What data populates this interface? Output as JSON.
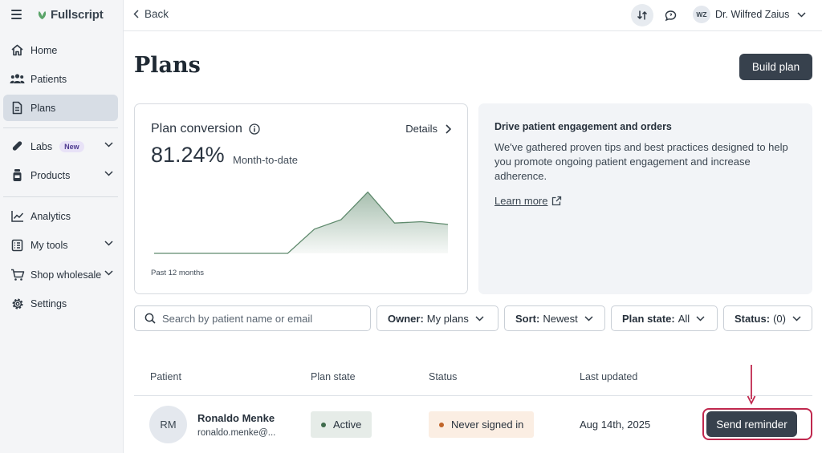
{
  "brand": {
    "name": "Fullscript"
  },
  "sidebar": {
    "items": [
      {
        "label": "Home",
        "icon": "home-icon"
      },
      {
        "label": "Patients",
        "icon": "patients-icon"
      },
      {
        "label": "Plans",
        "icon": "document-icon",
        "active": true
      },
      {
        "label": "Labs",
        "icon": "labs-icon",
        "badge": "New",
        "expandable": true
      },
      {
        "label": "Products",
        "icon": "bottle-icon",
        "expandable": true
      },
      {
        "label": "Analytics",
        "icon": "chart-line-icon"
      },
      {
        "label": "My tools",
        "icon": "tools-icon",
        "expandable": true
      },
      {
        "label": "Shop wholesale",
        "icon": "cart-icon",
        "expandable": true
      },
      {
        "label": "Settings",
        "icon": "gear-icon"
      }
    ]
  },
  "topbar": {
    "back_label": "Back",
    "user_initials": "WZ",
    "user_name": "Dr. Wilfred Zaius"
  },
  "page": {
    "title": "Plans",
    "build_plan_label": "Build plan"
  },
  "conversion_card": {
    "title": "Plan conversion",
    "details_label": "Details",
    "value": "81.24%",
    "value_caption": "Month-to-date",
    "footer": "Past 12 months",
    "accent_color": "#5f8a6d"
  },
  "chart_data": {
    "type": "area",
    "x": [
      1,
      2,
      3,
      4,
      5,
      6,
      7,
      8,
      9,
      10,
      11,
      12
    ],
    "values": [
      0,
      0,
      0,
      0,
      0,
      0,
      0.36,
      0.5,
      0.91,
      0.45,
      0.47,
      0.43
    ],
    "xlabel": "Past 12 months",
    "ylim": [
      0,
      1
    ],
    "grid": false,
    "axes_visible": false
  },
  "info_card": {
    "title": "Drive patient engagement and orders",
    "body": "We've gathered proven tips and best practices designed to help you promote ongoing patient engagement and increase adherence.",
    "link_label": "Learn more"
  },
  "filters": {
    "search_placeholder": "Search by patient name or email",
    "owner": {
      "key": "Owner:",
      "value": "My plans"
    },
    "sort": {
      "key": "Sort:",
      "value": "Newest"
    },
    "plan_state": {
      "key": "Plan state:",
      "value": "All"
    },
    "status": {
      "key": "Status:",
      "value": "(0)"
    }
  },
  "table": {
    "headers": [
      "Patient",
      "Plan state",
      "Status",
      "Last updated"
    ],
    "rows": [
      {
        "initials": "RM",
        "name": "Ronaldo Menke",
        "email": "ronaldo.menke@...",
        "plan_state": "Active",
        "plan_state_color": "#3f6b4c",
        "status": "Never signed in",
        "status_color": "#c0652a",
        "last_updated": "Aug 14th, 2025",
        "action_label": "Send reminder"
      }
    ]
  },
  "annotation": {
    "highlight_color": "#c0284e"
  }
}
